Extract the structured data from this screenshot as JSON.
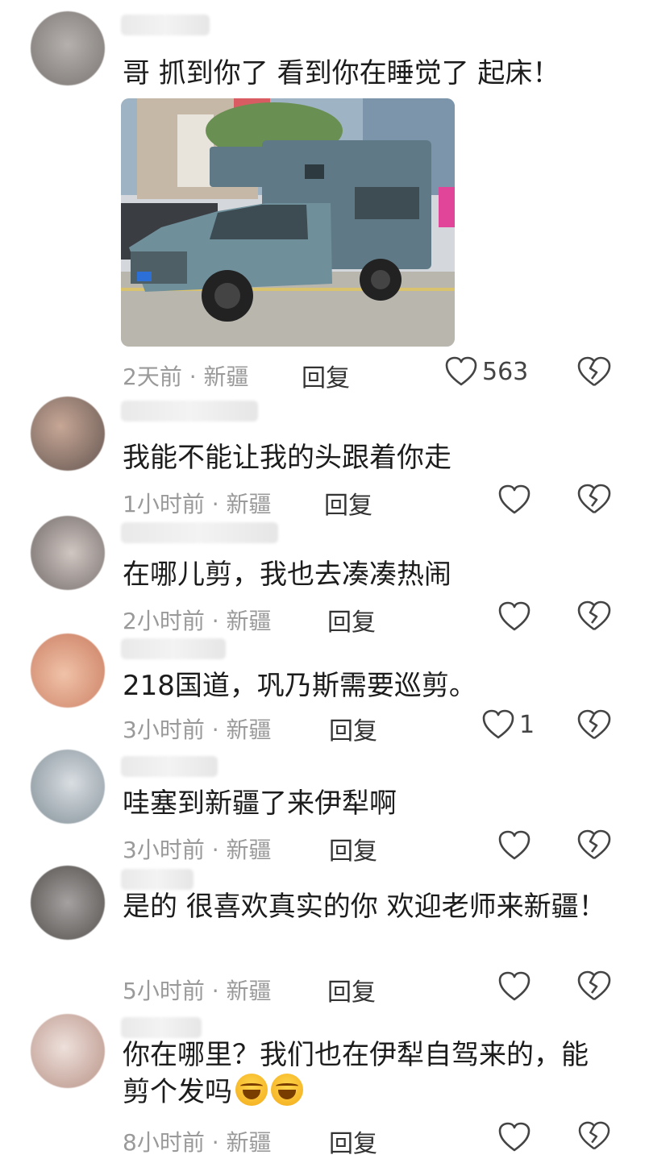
{
  "comments": [
    {
      "text": "哥 抓到你了 看到你在睡觉了 起床！",
      "time": "2天前",
      "location": "新疆",
      "reply_label": "回复",
      "like_count": "563",
      "has_photo": true
    },
    {
      "text": "我能不能让我的头跟着你走",
      "time": "1小时前",
      "location": "新疆",
      "reply_label": "回复",
      "like_count": ""
    },
    {
      "text": "在哪儿剪，我也去凑凑热闹",
      "time": "2小时前",
      "location": "新疆",
      "reply_label": "回复",
      "like_count": ""
    },
    {
      "text": "218国道，巩乃斯需要巡剪。",
      "time": "3小时前",
      "location": "新疆",
      "reply_label": "回复",
      "like_count": "1"
    },
    {
      "text": "哇塞到新疆了来伊犁啊",
      "time": "3小时前",
      "location": "新疆",
      "reply_label": "回复",
      "like_count": ""
    },
    {
      "text": "是的 很喜欢真实的你 欢迎老师来新疆！",
      "time": "5小时前",
      "location": "新疆",
      "reply_label": "回复",
      "like_count": ""
    },
    {
      "text": "你在哪里？我们也在伊犁自驾来的，能剪个发吗",
      "time": "8小时前",
      "location": "新疆",
      "reply_label": "回复",
      "like_count": "",
      "emojis": [
        "laughing-tears-emoji",
        "laughing-tears-emoji"
      ]
    }
  ],
  "meta_separator": "·",
  "icons": {
    "like": "heart-outline-icon",
    "dislike": "broken-heart-icon"
  },
  "colors": {
    "text": "#1c1c1c",
    "meta": "#9a9a9a",
    "truck": "#5f7a86"
  }
}
